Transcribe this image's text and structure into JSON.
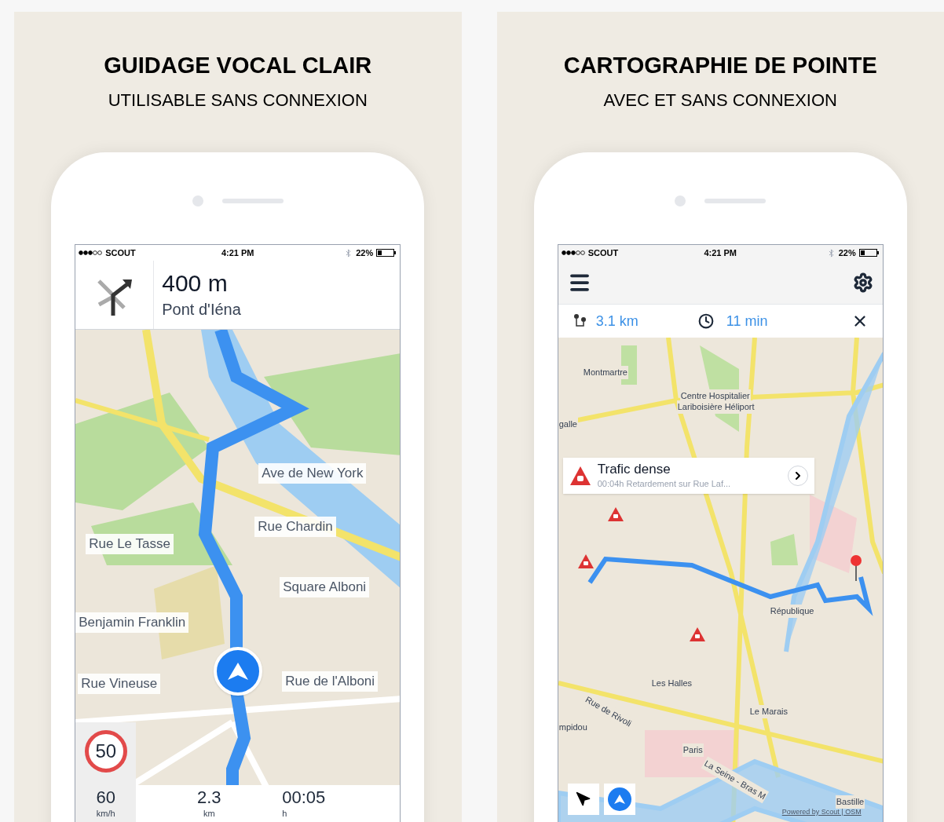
{
  "left_panel": {
    "title": "GUIDAGE VOCAL CLAIR",
    "subtitle": "UTILISABLE SANS CONNEXION",
    "status_bar": {
      "carrier": "SCOUT",
      "time": "4:21 PM",
      "battery": "22%"
    },
    "instruction": {
      "distance": "400 m",
      "street": "Pont d'Iéna"
    },
    "map_labels": [
      "Ave de New York",
      "Rue Chardin",
      "Rue Le Tasse",
      "Square Alboni",
      "Benjamin Franklin",
      "Rue Vineuse",
      "Rue de l'Alboni"
    ],
    "speed_limit": "50",
    "trip": [
      {
        "value": "60",
        "unit": "km/h"
      },
      {
        "value": "2.3",
        "unit": "km"
      },
      {
        "value": "00:05",
        "unit": "h"
      }
    ]
  },
  "right_panel": {
    "title": "CARTOGRAPHIE DE POINTE",
    "subtitle": "AVEC ET SANS CONNEXION",
    "status_bar": {
      "carrier": "SCOUT",
      "time": "4:21 PM",
      "battery": "22%"
    },
    "route": {
      "distance": "3.1 km",
      "duration": "11 min"
    },
    "alert": {
      "title": "Trafic dense",
      "detail": "00:04h Retardement sur Rue Laf..."
    },
    "map_labels": [
      "Montmartre",
      "Centre Hospitalier",
      "Lariboisière Héliport",
      "galle",
      "République",
      "Les Halles",
      "Le Marais",
      "Rue de Rivoli",
      "mpidou",
      "Paris",
      "Bastille",
      "La Seine - Bras M"
    ],
    "attribution": "Powered by Scout | OSM"
  }
}
